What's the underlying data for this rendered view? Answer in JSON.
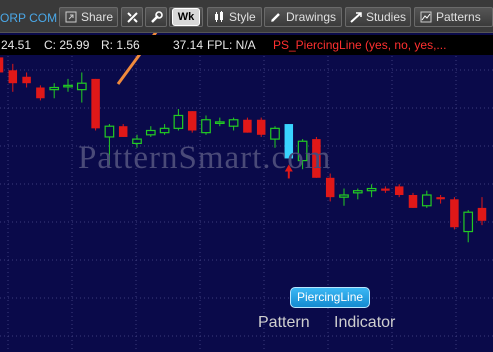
{
  "toolbar": {
    "symbol_fragment": "ORP COM",
    "share_label": "Share",
    "period_label": "Wk",
    "style_label": "Style",
    "drawings_label": "Drawings",
    "studies_label": "Studies",
    "patterns_label": "Patterns"
  },
  "infobar": {
    "open_fragment": "24.51",
    "close": "C: 25.99",
    "range": "R: 1.56",
    "volume_fragment": "37.14",
    "fpl": "FPL: N/A",
    "study": "PS_PiercingLine (yes, no, yes,..."
  },
  "watermark": "PatternSmart.com",
  "pattern_badge": "PiercingLine",
  "annotations": {
    "pattern": "Pattern",
    "indicator": "Indicator"
  },
  "colors": {
    "background": "#0a0a4a",
    "grid_dot": "#3c3c7c",
    "up_candle": "#22cc22",
    "down_candle": "#e01818",
    "pattern_candle": "#39d4ff",
    "annotation_arrow": "#f08a3c"
  },
  "chart_data": {
    "type": "candlestick",
    "candles": [
      {
        "o": 64,
        "h": 66,
        "l": 55,
        "c": 57
      },
      {
        "o": 58,
        "h": 61,
        "l": 48,
        "c": 52
      },
      {
        "o": 55,
        "h": 57,
        "l": 50,
        "c": 52
      },
      {
        "o": 50,
        "h": 51,
        "l": 44,
        "c": 45
      },
      {
        "o": 49,
        "h": 52,
        "l": 45,
        "c": 50
      },
      {
        "o": 51,
        "h": 54,
        "l": 48,
        "c": 51
      },
      {
        "o": 49,
        "h": 57,
        "l": 43,
        "c": 52
      },
      {
        "o": 54,
        "h": 54,
        "l": 30,
        "c": 31
      },
      {
        "o": 27,
        "h": 33,
        "l": 14,
        "c": 32
      },
      {
        "o": 32,
        "h": 33,
        "l": 27,
        "c": 27
      },
      {
        "o": 24,
        "h": 28,
        "l": 22,
        "c": 26
      },
      {
        "o": 28,
        "h": 32,
        "l": 27,
        "c": 30
      },
      {
        "o": 29,
        "h": 33,
        "l": 28,
        "c": 31
      },
      {
        "o": 31,
        "h": 40,
        "l": 30,
        "c": 37
      },
      {
        "o": 39,
        "h": 39,
        "l": 29,
        "c": 30
      },
      {
        "o": 29,
        "h": 37,
        "l": 28,
        "c": 35
      },
      {
        "o": 34,
        "h": 36,
        "l": 32,
        "c": 34
      },
      {
        "o": 32,
        "h": 36,
        "l": 30,
        "c": 35
      },
      {
        "o": 35,
        "h": 36,
        "l": 29,
        "c": 29
      },
      {
        "o": 35,
        "h": 36,
        "l": 27,
        "c": 28
      },
      {
        "o": 26,
        "h": 32,
        "l": 22,
        "c": 31
      },
      {
        "o": 33,
        "h": 33,
        "l": 17,
        "c": 17
      },
      {
        "o": 16,
        "h": 26,
        "l": 12,
        "c": 25
      },
      {
        "o": 26,
        "h": 27,
        "l": 8,
        "c": 8
      },
      {
        "o": 8,
        "h": 10,
        "l": -3,
        "c": -1
      },
      {
        "o": -1,
        "h": 3,
        "l": -5,
        "c": 0
      },
      {
        "o": 1,
        "h": 3,
        "l": -2,
        "c": 2
      },
      {
        "o": 2,
        "h": 5,
        "l": -1,
        "c": 3
      },
      {
        "o": 3,
        "h": 4,
        "l": 1,
        "c": 2
      },
      {
        "o": 4,
        "h": 5,
        "l": -1,
        "c": 0
      },
      {
        "o": 0,
        "h": 1,
        "l": -6,
        "c": -6
      },
      {
        "o": -5,
        "h": 2,
        "l": -6,
        "c": 0
      },
      {
        "o": -1,
        "h": 0,
        "l": -4,
        "c": -2
      },
      {
        "o": -2,
        "h": -1,
        "l": -16,
        "c": -15
      },
      {
        "o": -17,
        "h": -7,
        "l": -22,
        "c": -8
      },
      {
        "o": -6,
        "h": -1,
        "l": -14,
        "c": -12
      }
    ],
    "pattern_index": 21
  }
}
